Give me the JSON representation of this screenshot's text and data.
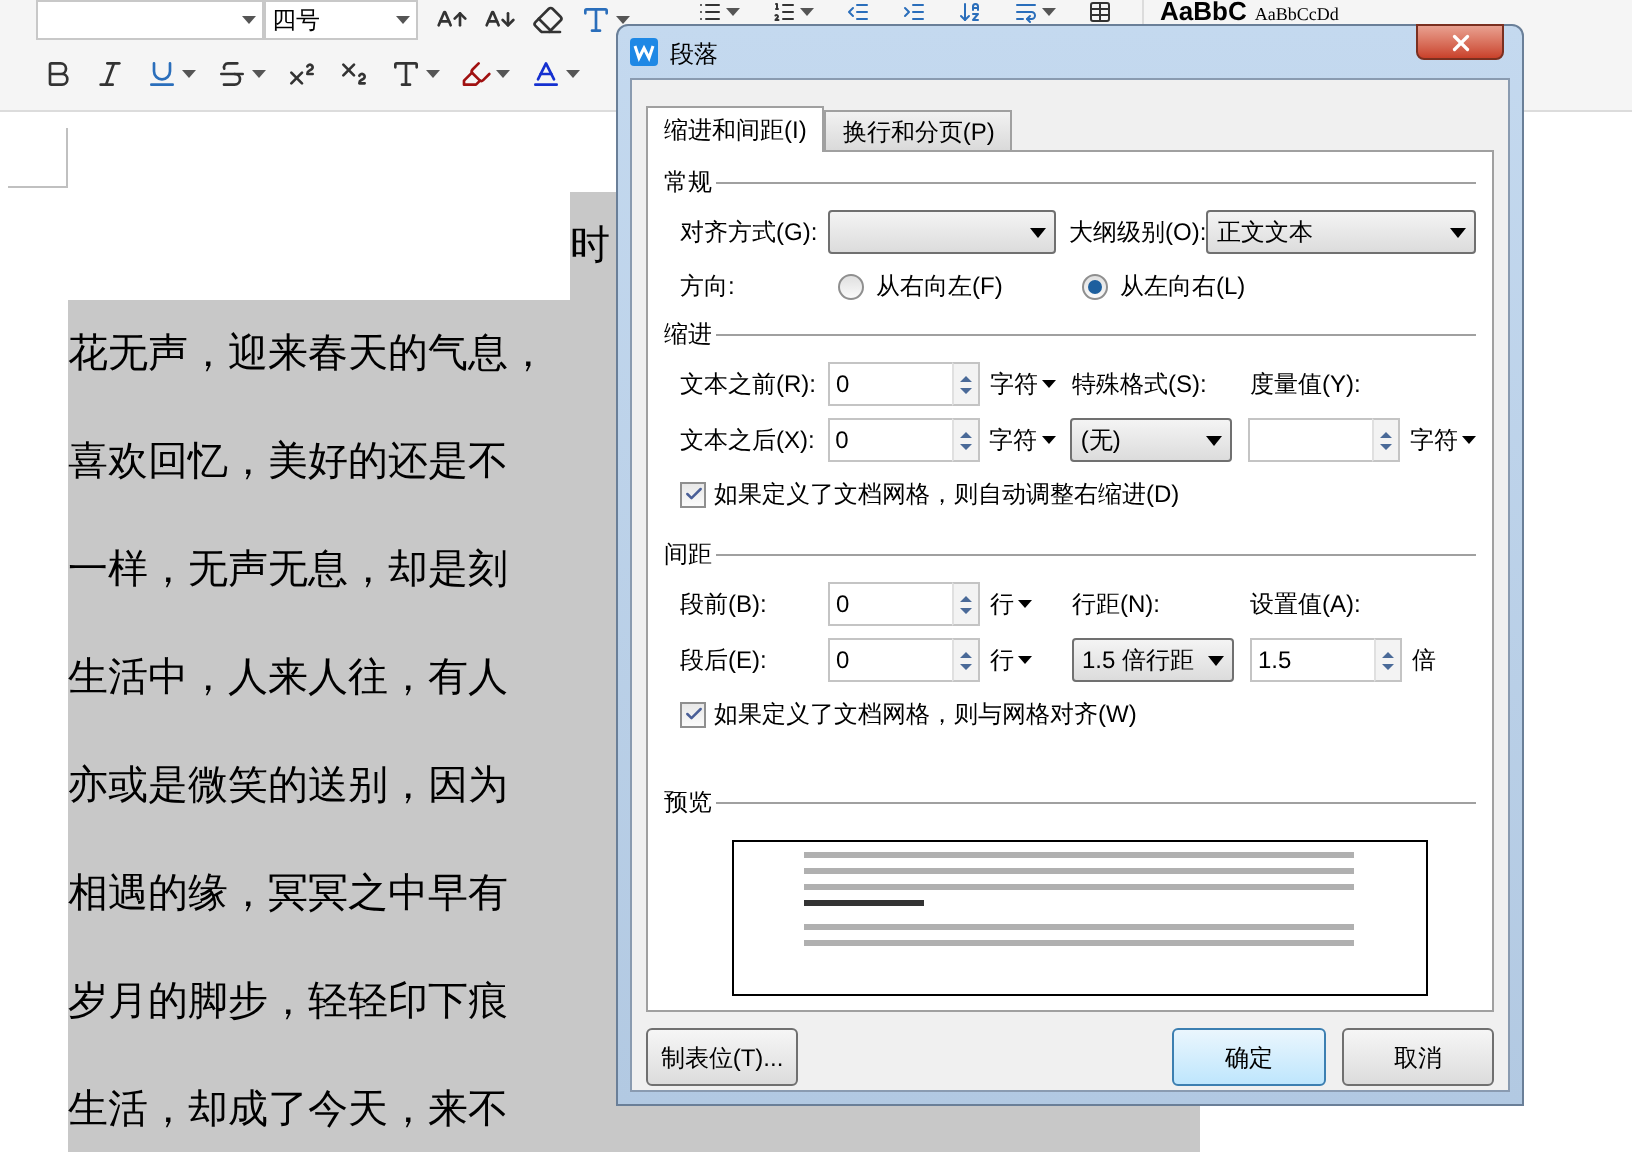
{
  "toolbar": {
    "font_size": "四号",
    "styles": [
      "AaBbC",
      "AaBbCcDd"
    ]
  },
  "document": {
    "first_line": "时",
    "lines": [
      "花无声，迎来春天的气息，",
      "喜欢回忆，美好的还是不",
      "一样，无声无息，却是刻",
      "生活中，人来人往，有人",
      "亦或是微笑的送别，因为",
      "相遇的缘，冥冥之中早有",
      "岁月的脚步，轻轻印下痕",
      "生活，却成了今天，来不"
    ]
  },
  "dialog": {
    "title": "段落",
    "tabs": [
      {
        "label": "缩进和间距(I)",
        "selected": true
      },
      {
        "label": "换行和分页(P)",
        "selected": false
      }
    ],
    "general": {
      "heading": "常规",
      "alignment": {
        "label": "对齐方式(G):"
      },
      "outline": {
        "label": "大纲级别(O):",
        "value": "正文文本"
      },
      "direction": {
        "label": "方向:",
        "options": [
          {
            "label": "从右向左(F)",
            "selected": false
          },
          {
            "label": "从左向右(L)",
            "selected": true
          }
        ]
      }
    },
    "indent": {
      "heading": "缩进",
      "rows": [
        {
          "label": "文本之前(R):",
          "value": "0",
          "unit": "字符"
        },
        {
          "label": "文本之后(X):",
          "value": "0",
          "unit": "字符"
        }
      ],
      "special": {
        "label": "特殊格式(S):",
        "value": "(无)"
      },
      "measure": {
        "label": "度量值(Y):",
        "unit": "字符"
      },
      "checkbox": {
        "label": "如果定义了文档网格，则自动调整右缩进(D)",
        "checked": true
      }
    },
    "spacing": {
      "heading": "间距",
      "rows": [
        {
          "label": "段前(B):",
          "value": "0",
          "unit": "行"
        },
        {
          "label": "段后(E):",
          "value": "0",
          "unit": "行"
        }
      ],
      "line_spacing": {
        "label": "行距(N):",
        "value": "1.5 倍行距"
      },
      "setting": {
        "label": "设置值(A):",
        "value": "1.5",
        "unit": "倍"
      },
      "checkbox": {
        "label": "如果定义了文档网格，则与网格对齐(W)",
        "checked": true
      }
    },
    "preview": {
      "heading": "预览"
    },
    "buttons": {
      "tabs": "制表位(T)...",
      "ok": "确定",
      "cancel": "取消"
    }
  }
}
